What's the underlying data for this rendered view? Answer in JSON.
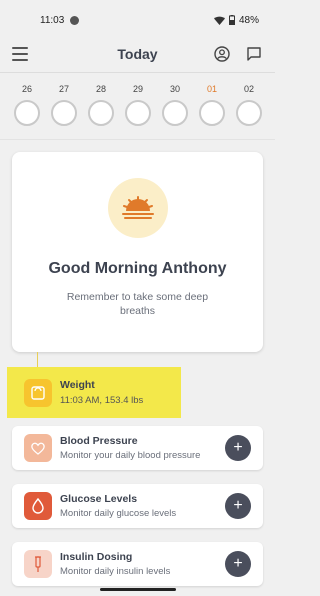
{
  "status_bar": {
    "time": "11:03",
    "battery": "48%"
  },
  "header": {
    "title": "Today"
  },
  "dates": [
    {
      "day": "26",
      "today": false
    },
    {
      "day": "27",
      "today": false
    },
    {
      "day": "28",
      "today": false
    },
    {
      "day": "29",
      "today": false
    },
    {
      "day": "30",
      "today": false
    },
    {
      "day": "01",
      "today": true
    },
    {
      "day": "02",
      "today": false
    }
  ],
  "greeting": {
    "title": "Good Morning Anthony",
    "subtitle": "Remember to take some deep breaths"
  },
  "weight": {
    "title": "Weight",
    "detail": "11:03 AM, 153.4 lbs",
    "highlight_color": "#f3e84a"
  },
  "trackers": [
    {
      "title": "Blood Pressure",
      "subtitle": "Monitor your daily blood pressure",
      "icon": "heart-icon",
      "icon_color": "#f3b89a"
    },
    {
      "title": "Glucose Levels",
      "subtitle": "Monitor daily glucose levels",
      "icon": "drop-icon",
      "icon_color": "#e05a3a"
    },
    {
      "title": "Insulin Dosing",
      "subtitle": "Monitor daily insulin levels",
      "icon": "syringe-icon",
      "icon_color": "#f7d4c8"
    }
  ],
  "colors": {
    "accent": "#e07a2a",
    "dark_button": "#4a4e5c"
  }
}
